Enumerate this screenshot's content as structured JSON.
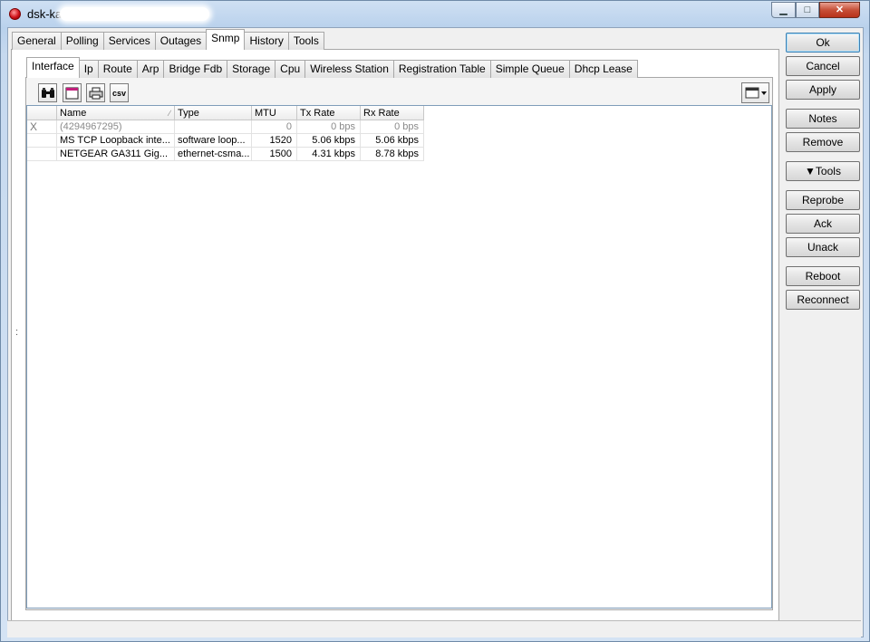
{
  "window": {
    "title": "dsk-ka",
    "minimize_glyph": "▁",
    "maximize_glyph": "□",
    "close_glyph": "✕"
  },
  "main_tabs": [
    {
      "label": "General"
    },
    {
      "label": "Polling"
    },
    {
      "label": "Services"
    },
    {
      "label": "Outages"
    },
    {
      "label": "Snmp"
    },
    {
      "label": "History"
    },
    {
      "label": "Tools"
    }
  ],
  "snmp_tabs": [
    {
      "label": "Interface"
    },
    {
      "label": "Ip"
    },
    {
      "label": "Route"
    },
    {
      "label": "Arp"
    },
    {
      "label": "Bridge Fdb"
    },
    {
      "label": "Storage"
    },
    {
      "label": "Cpu"
    },
    {
      "label": "Wireless Station"
    },
    {
      "label": "Registration Table"
    },
    {
      "label": "Simple Queue"
    },
    {
      "label": "Dhcp Lease"
    }
  ],
  "toolbar": {
    "find_icon": "binoculars-icon",
    "window_icon": "window-icon",
    "print_icon": "printer-icon",
    "csv_label": "csv"
  },
  "table": {
    "columns": [
      "",
      "Name",
      "Type",
      "MTU",
      "Tx Rate",
      "Rx Rate"
    ],
    "rows": [
      {
        "flag": "X",
        "name": "(4294967295)",
        "type": "",
        "mtu": "0",
        "tx": "0 bps",
        "rx": "0 bps"
      },
      {
        "flag": "",
        "name": "MS TCP Loopback inte...",
        "type": "software loop...",
        "mtu": "1520",
        "tx": "5.06 kbps",
        "rx": "5.06 kbps"
      },
      {
        "flag": "",
        "name": "NETGEAR GA311 Gig...",
        "type": "ethernet-csma...",
        "mtu": "1500",
        "tx": "4.31 kbps",
        "rx": "8.78 kbps"
      }
    ]
  },
  "side_buttons": {
    "ok": "Ok",
    "cancel": "Cancel",
    "apply": "Apply",
    "notes": "Notes",
    "remove": "Remove",
    "tools": "▼Tools",
    "reprobe": "Reprobe",
    "ack": "Ack",
    "unack": "Unack",
    "reboot": "Reboot",
    "reconnect": "Reconnect"
  },
  "misc": {
    "splitter_dots": ":"
  }
}
